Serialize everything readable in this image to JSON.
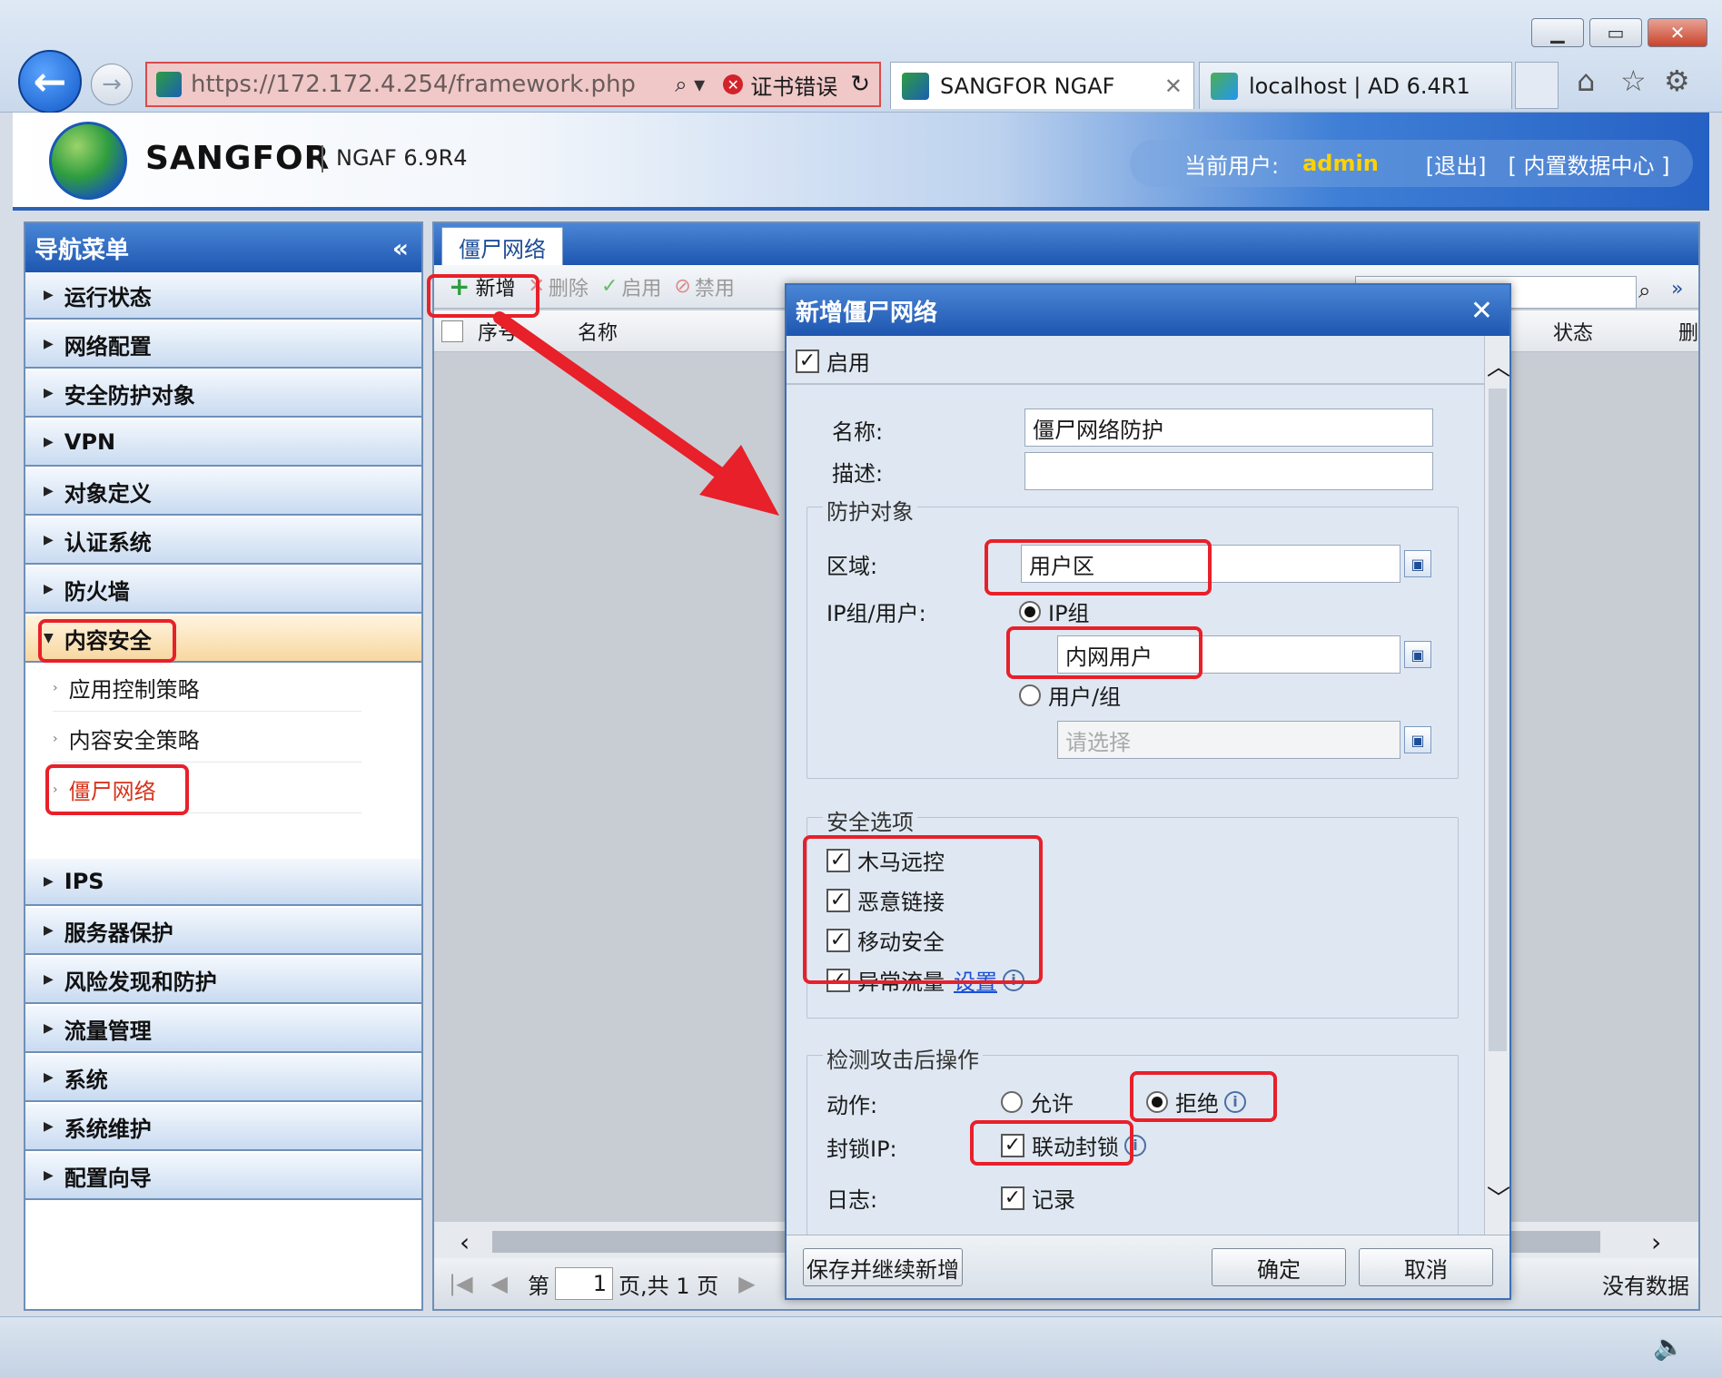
{
  "browser": {
    "address_url": "https://172.172.4.254/framework.php",
    "cert_error": "证书错误",
    "tabs": [
      {
        "title": "SANGFOR NGAF"
      },
      {
        "title": "localhost | AD 6.4R1"
      }
    ]
  },
  "header": {
    "brand": "SANGFOR",
    "version": "NGAF 6.9R4",
    "current_user_label": "当前用户:",
    "user_name": "admin",
    "logout": "[退出]",
    "datacenter": "[ 内置数据中心 ]"
  },
  "sidebar": {
    "title": "导航菜单",
    "collapse": "«",
    "items": [
      {
        "label": "运行状态"
      },
      {
        "label": "网络配置"
      },
      {
        "label": "安全防护对象"
      },
      {
        "label": "VPN"
      },
      {
        "label": "对象定义"
      },
      {
        "label": "认证系统"
      },
      {
        "label": "防火墙"
      },
      {
        "label": "内容安全"
      },
      {
        "label": "IPS"
      },
      {
        "label": "服务器保护"
      },
      {
        "label": "风险发现和防护"
      },
      {
        "label": "流量管理"
      },
      {
        "label": "系统"
      },
      {
        "label": "系统维护"
      },
      {
        "label": "配置向导"
      }
    ],
    "sub_items": [
      {
        "label": "应用控制策略"
      },
      {
        "label": "内容安全策略"
      },
      {
        "label": "僵尸网络"
      }
    ]
  },
  "content": {
    "tab": "僵尸网络",
    "toolbar": {
      "add": "新增",
      "delete": "删除",
      "enable": "启用",
      "disable": "禁用"
    },
    "columns": {
      "index": "序号",
      "name": "名称",
      "status": "状态",
      "delete": "删"
    },
    "pager": {
      "prefix": "第",
      "page": "1",
      "suffix": "页,共 1 页",
      "no_data": "没有数据"
    }
  },
  "dialog": {
    "title": "新增僵尸网络",
    "enable_label": "启用",
    "name_label": "名称:",
    "name_value": "僵尸网络防护",
    "desc_label": "描述:",
    "desc_value": "",
    "protect_section": "防护对象",
    "zone_label": "区域:",
    "zone_value": "用户区",
    "ip_user_label": "IP组/用户:",
    "ipgroup_option": "IP组",
    "ipgroup_value": "内网用户",
    "user_option": "用户/组",
    "user_placeholder": "请选择",
    "security_section": "安全选项",
    "options": [
      {
        "label": "木马远控"
      },
      {
        "label": "恶意链接"
      },
      {
        "label": "移动安全"
      },
      {
        "label": "异常流量"
      }
    ],
    "settings_link": "设置",
    "action_section": "检测攻击后操作",
    "action_label": "动作:",
    "allow_option": "允许",
    "deny_option": "拒绝",
    "block_ip_label": "封锁IP:",
    "linked_block": "联动封锁",
    "log_label": "日志:",
    "log_record": "记录",
    "save_continue": "保存并继续新增",
    "ok": "确定",
    "cancel": "取消"
  }
}
